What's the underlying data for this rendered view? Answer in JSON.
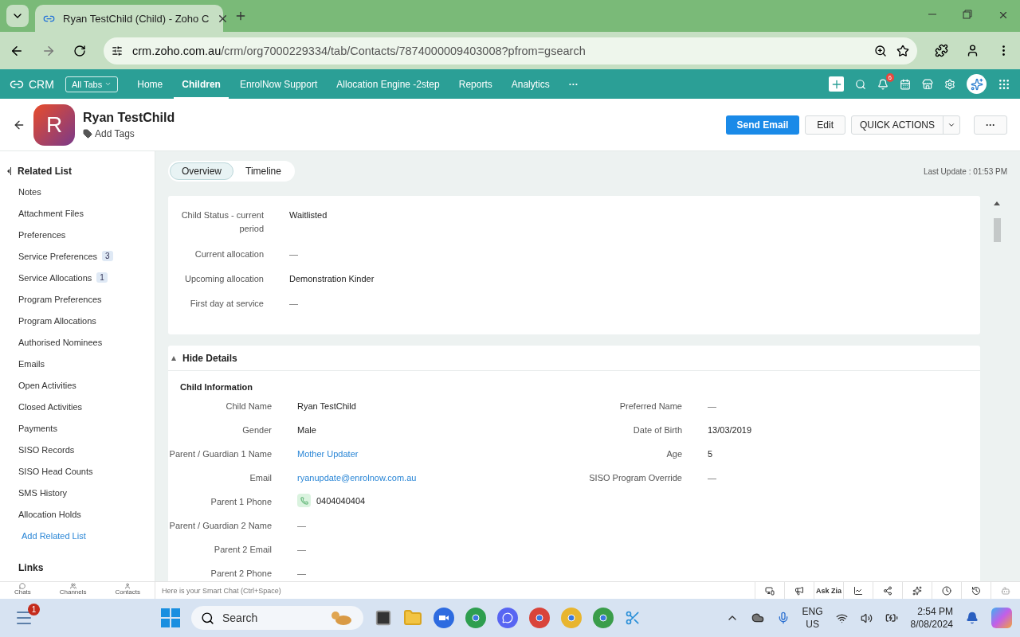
{
  "browser": {
    "tab_title": "Ryan TestChild (Child) - Zoho C",
    "url_host": "crm.zoho.com.au",
    "url_path": "/crm/org7000229334/tab/Contacts/7874000009403008?pfrom=gsearch"
  },
  "crm_nav": {
    "brand": "CRM",
    "all_tabs": "All Tabs",
    "items": [
      {
        "label": "Home",
        "selected": false
      },
      {
        "label": "Children",
        "selected": true
      },
      {
        "label": "EnrolNow Support",
        "selected": false
      },
      {
        "label": "Allocation Engine -2step",
        "selected": false
      },
      {
        "label": "Reports",
        "selected": false
      },
      {
        "label": "Analytics",
        "selected": false
      }
    ],
    "more": "···",
    "notification_count": "6"
  },
  "record": {
    "initial": "R",
    "name": "Ryan TestChild",
    "add_tags": "Add Tags",
    "buttons": {
      "send_email": "Send Email",
      "edit": "Edit",
      "quick_actions": "QUICK ACTIONS",
      "more": "···"
    }
  },
  "related_list": {
    "title": "Related List",
    "items": [
      {
        "label": "Notes"
      },
      {
        "label": "Attachment Files"
      },
      {
        "label": "Preferences"
      },
      {
        "label": "Service Preferences",
        "count": "3"
      },
      {
        "label": "Service Allocations",
        "count": "1"
      },
      {
        "label": "Program Preferences"
      },
      {
        "label": "Program Allocations"
      },
      {
        "label": "Authorised Nominees"
      },
      {
        "label": "Emails"
      },
      {
        "label": "Open Activities"
      },
      {
        "label": "Closed Activities"
      },
      {
        "label": "Payments"
      },
      {
        "label": "SISO Records"
      },
      {
        "label": "SISO Head Counts"
      },
      {
        "label": "SMS History"
      },
      {
        "label": "Allocation Holds"
      }
    ],
    "add_link": "Add Related List",
    "links_title": "Links"
  },
  "view_tabs": [
    {
      "label": "Overview",
      "selected": true
    },
    {
      "label": "Timeline",
      "selected": false
    }
  ],
  "last_update": "Last Update : 01:53 PM",
  "overview_fields": [
    {
      "label": "Child Status - current period",
      "value": "Waitlisted",
      "kind": "text"
    },
    {
      "label": "Current allocation",
      "value": "—",
      "kind": "empty"
    },
    {
      "label": "Upcoming allocation",
      "value": "Demonstration Kinder",
      "kind": "text"
    },
    {
      "label": "First day at service",
      "value": "—",
      "kind": "empty"
    }
  ],
  "details": {
    "toggle": "Hide Details",
    "section_title": "Child Information",
    "left_fields": [
      {
        "label": "Child Name",
        "value": "Ryan TestChild",
        "kind": "text"
      },
      {
        "label": "Gender",
        "value": "Male",
        "kind": "text"
      },
      {
        "label": "Parent / Guardian 1 Name",
        "value": "Mother Updater",
        "kind": "link"
      },
      {
        "label": "Email",
        "value": "ryanupdate@enrolnow.com.au",
        "kind": "link"
      },
      {
        "label": "Parent 1 Phone",
        "value": "0404040404",
        "kind": "phone"
      },
      {
        "label": "Parent / Guardian 2 Name",
        "value": "—",
        "kind": "empty"
      },
      {
        "label": "Parent 2 Email",
        "value": "—",
        "kind": "empty"
      },
      {
        "label": "Parent 2 Phone",
        "value": "—",
        "kind": "empty"
      }
    ],
    "right_fields": [
      {
        "label": "Preferred Name",
        "value": "—",
        "kind": "empty"
      },
      {
        "label": "Date of Birth",
        "value": "13/03/2019",
        "kind": "text"
      },
      {
        "label": "Age",
        "value": "5",
        "kind": "text"
      },
      {
        "label": "SISO Program Override",
        "value": "—",
        "kind": "empty"
      }
    ]
  },
  "smart_chat": {
    "tabs": [
      "Chats",
      "Channels",
      "Contacts"
    ],
    "placeholder": "Here is your Smart Chat (Ctrl+Space)",
    "ask_zia": "Ask Zia"
  },
  "taskbar": {
    "widget_badge": "1",
    "search_placeholder": "Search",
    "language": "ENG",
    "region": "US",
    "time": "2:54 PM",
    "date": "8/08/2024"
  }
}
